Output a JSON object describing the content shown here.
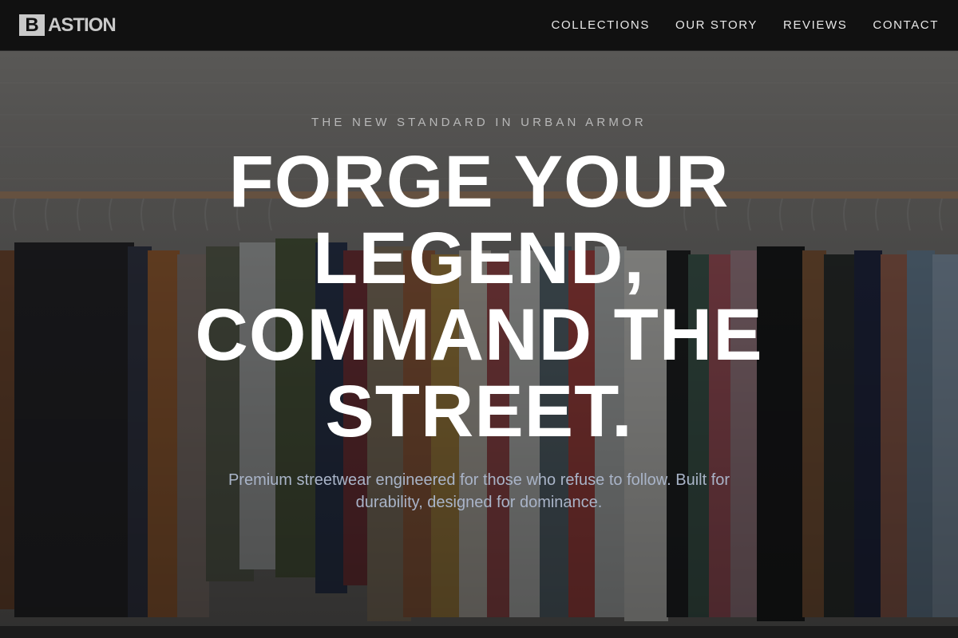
{
  "brand": {
    "mark": "B",
    "name": "ASTION"
  },
  "nav": {
    "links": [
      {
        "label": "COLLECTIONS"
      },
      {
        "label": "OUR STORY"
      },
      {
        "label": "REVIEWS"
      },
      {
        "label": "CONTACT"
      }
    ]
  },
  "hero": {
    "eyebrow": "THE NEW STANDARD IN URBAN ARMOR",
    "headline": "FORGE YOUR LEGEND, COMMAND THE STREET.",
    "subtext": "Premium streetwear engineered for those who refuse to follow. Built for durability, designed for dominance."
  },
  "colors": {
    "nav_background": "#111111",
    "text_primary": "#ffffff",
    "eyebrow": "#b8b8b8",
    "subtext": "#a9b4c8",
    "logo": "#c9c9c9"
  }
}
